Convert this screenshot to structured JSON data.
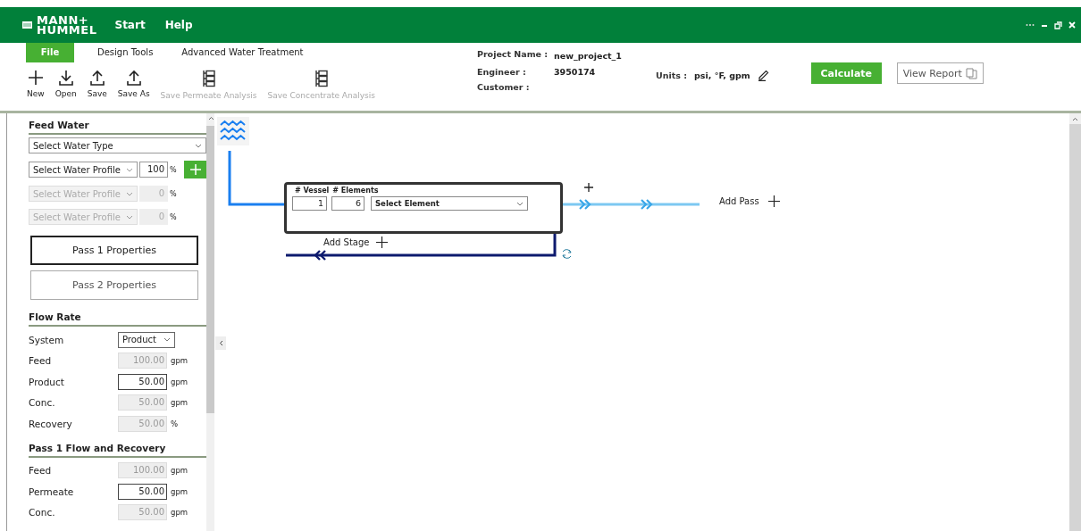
{
  "header": {
    "logo": [
      "MANN+",
      "HUMMEL"
    ],
    "menu": [
      "Start",
      "Help"
    ]
  },
  "ribbon": {
    "tabs": [
      {
        "label": "File",
        "selected": true
      },
      {
        "label": "Design Tools",
        "selected": false
      },
      {
        "label": "Advanced Water Treatment",
        "selected": false
      }
    ],
    "tools": [
      {
        "label": "New",
        "disabled": false
      },
      {
        "label": "Open",
        "disabled": false
      },
      {
        "label": "Save",
        "disabled": false
      },
      {
        "label": "Save As",
        "disabled": false
      },
      {
        "label": "Save Permeate Analysis",
        "disabled": true
      },
      {
        "label": "Save Concentrate Analysis",
        "disabled": true
      }
    ],
    "project": [
      {
        "label": "Project Name :",
        "value": "new_project_1"
      },
      {
        "label": "Engineer :",
        "value": "3950174"
      },
      {
        "label": "Customer :"
      }
    ],
    "units": {
      "label": "Units :",
      "value": "psi, °F, gpm"
    },
    "calculate": "Calculate",
    "view_report": "View Report"
  },
  "sidebar": {
    "feed_water": {
      "title": "Feed Water",
      "water_type": "Select Water Type",
      "profiles": [
        {
          "value": "Select Water Profile",
          "percent": "100",
          "unit": "%",
          "disabled": false
        },
        {
          "value": "Select Water Profile",
          "percent": "0",
          "unit": "%",
          "disabled": true
        },
        {
          "value": "Select Water Profile",
          "percent": "0",
          "unit": "%",
          "disabled": true
        }
      ]
    },
    "pass_buttons": [
      {
        "label": "Pass 1 Properties",
        "selected": true
      },
      {
        "label": "Pass 2 Properties",
        "selected": false
      }
    ],
    "sections": [
      {
        "title": "Flow Rate",
        "rows": [
          {
            "label": "System",
            "kind": "select",
            "value": "Product"
          },
          {
            "label": "Feed",
            "kind": "input",
            "value": "100.00",
            "unit": "gpm",
            "disabled": true
          },
          {
            "label": "Product",
            "kind": "input",
            "value": "50.00",
            "unit": "gpm",
            "disabled": false
          },
          {
            "label": "Conc.",
            "kind": "input",
            "value": "50.00",
            "unit": "gpm",
            "disabled": true
          },
          {
            "label": "Recovery",
            "kind": "input",
            "value": "50.00",
            "unit": "%",
            "disabled": true
          }
        ]
      },
      {
        "title": "Pass 1 Flow and Recovery",
        "rows": [
          {
            "label": "Feed",
            "kind": "input",
            "value": "100.00",
            "unit": "gpm",
            "disabled": true
          },
          {
            "label": "Permeate",
            "kind": "input",
            "value": "50.00",
            "unit": "gpm",
            "disabled": false
          },
          {
            "label": "Conc.",
            "kind": "input",
            "value": "50.00",
            "unit": "gpm",
            "disabled": true
          }
        ]
      }
    ]
  },
  "canvas": {
    "vessel_label": "# Vessel",
    "elements_label": "# Elements",
    "vessel_count": "1",
    "element_count": "6",
    "element_select": "Select Element",
    "add_pass": "Add Pass",
    "add_stage": "Add Stage"
  }
}
